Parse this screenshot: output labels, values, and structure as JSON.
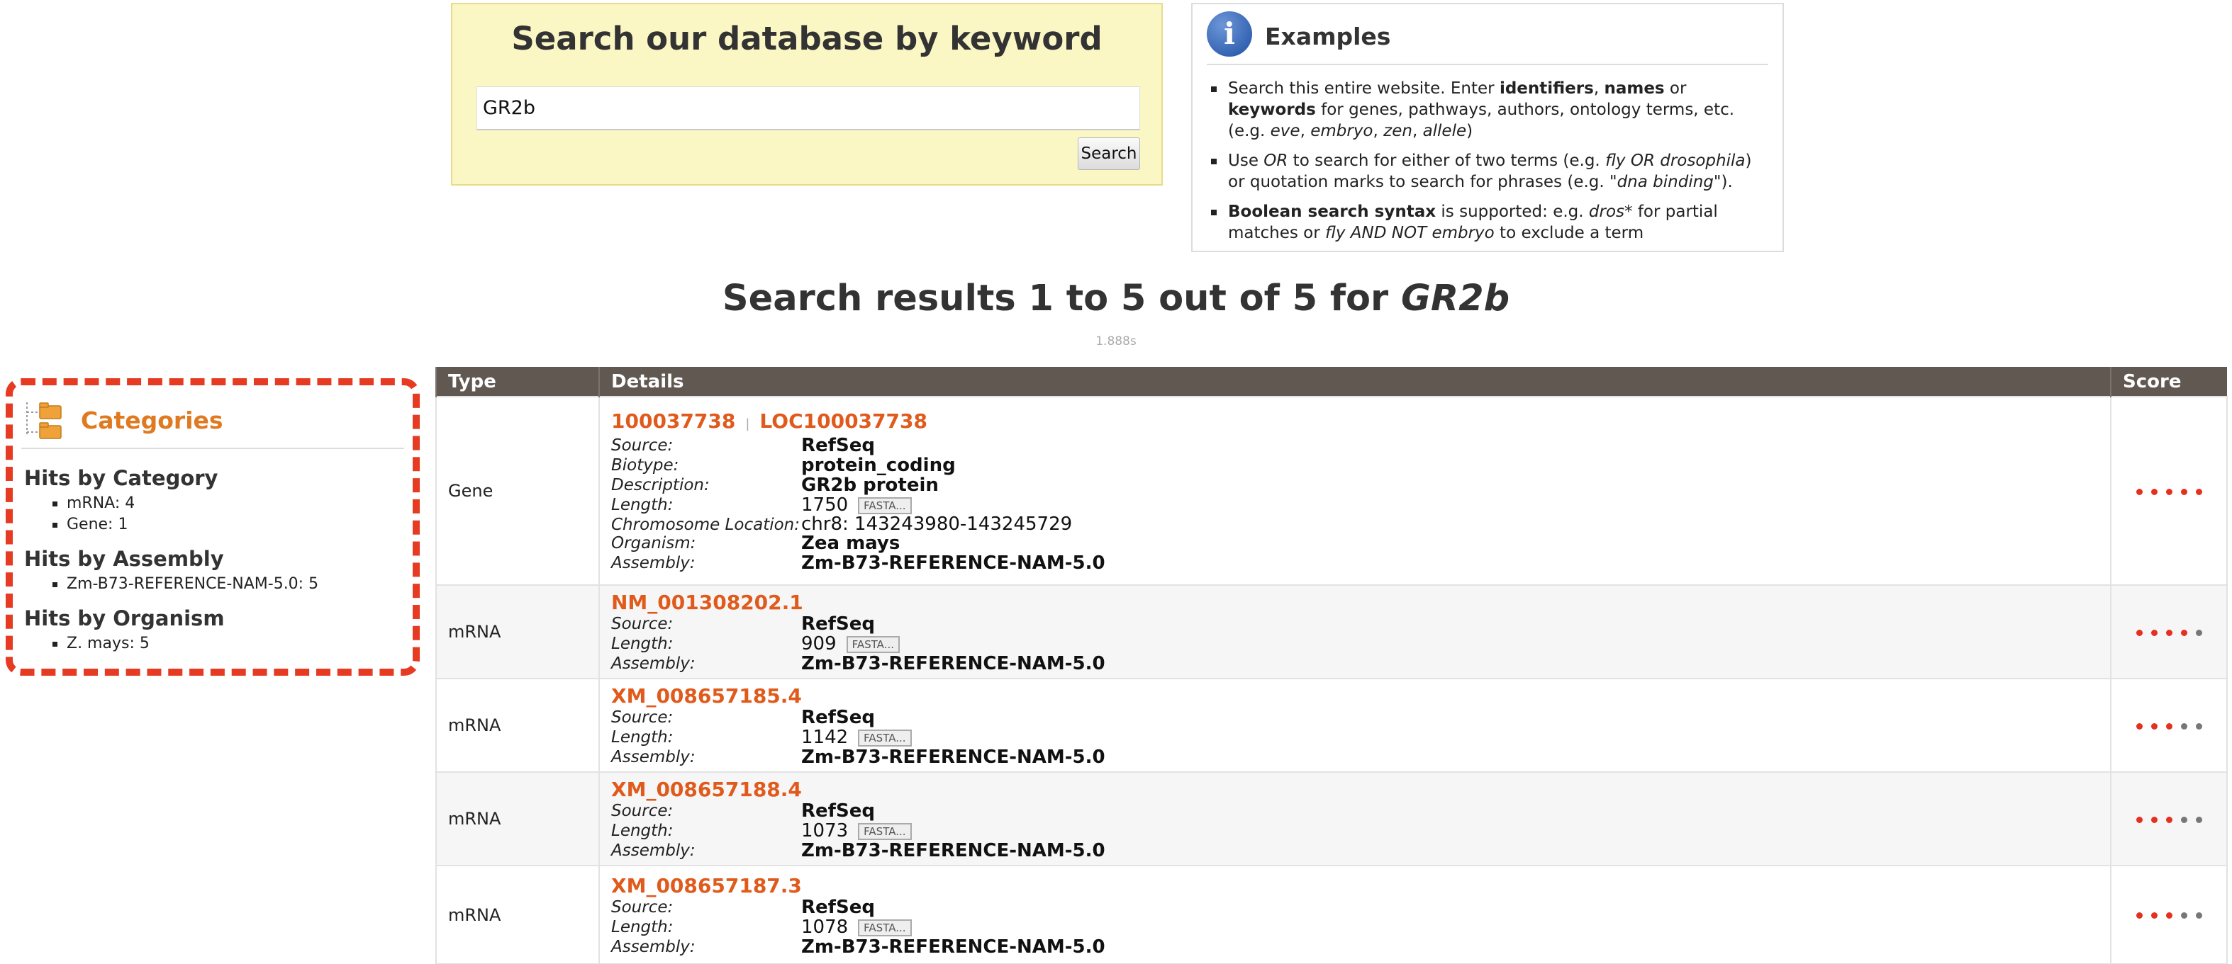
{
  "search": {
    "title": "Search our database by keyword",
    "query": "GR2b",
    "button_label": "Search"
  },
  "examples": {
    "title": "Examples",
    "items": [
      "Search this entire website. Enter identifiers, names or keywords for genes, pathways, authors, ontology terms, etc. (e.g. eve, embryo, zen, allele)",
      "Use OR to search for either of two terms (e.g. fly OR drosophila) or quotation marks to search for phrases (e.g. \"dna binding\").",
      "Boolean search syntax is supported: e.g. dros* for partial matches or fly AND NOT embryo to exclude a term"
    ]
  },
  "results": {
    "heading_prefix": "Search results 1 to 5 out of 5 for ",
    "heading_term": "GR2b",
    "timing": "1.888s"
  },
  "categories": {
    "title": "Categories",
    "groups": [
      {
        "heading": "Hits by Category",
        "items": [
          "mRNA: 4",
          "Gene: 1"
        ]
      },
      {
        "heading": "Hits by Assembly",
        "items": [
          "Zm-B73-REFERENCE-NAM-5.0: 5"
        ]
      },
      {
        "heading": "Hits by Organism",
        "items": [
          "Z. mays: 5"
        ]
      }
    ]
  },
  "table": {
    "columns": [
      "Type",
      "Details",
      "Score"
    ],
    "fasta_label": "FASTA...",
    "labels": {
      "source": "Source:",
      "biotype": "Biotype:",
      "description": "Description:",
      "length": "Length:",
      "chromosome_location": "Chromosome Location:",
      "organism": "Organism:",
      "assembly": "Assembly:"
    },
    "rows": [
      {
        "type": "Gene",
        "id": "100037738",
        "alt_id": "LOC100037738",
        "source": "RefSeq",
        "biotype": "protein_coding",
        "description": "GR2b protein",
        "length": "1750",
        "chromosome_location": "chr8: 143243980-143245729",
        "organism": "Zea mays",
        "assembly": "Zm-B73-REFERENCE-NAM-5.0",
        "score": 5
      },
      {
        "type": "mRNA",
        "id": "NM_001308202.1",
        "source": "RefSeq",
        "length": "909",
        "assembly": "Zm-B73-REFERENCE-NAM-5.0",
        "score": 4
      },
      {
        "type": "mRNA",
        "id": "XM_008657185.4",
        "source": "RefSeq",
        "length": "1142",
        "assembly": "Zm-B73-REFERENCE-NAM-5.0",
        "score": 3
      },
      {
        "type": "mRNA",
        "id": "XM_008657188.4",
        "source": "RefSeq",
        "length": "1073",
        "assembly": "Zm-B73-REFERENCE-NAM-5.0",
        "score": 3
      },
      {
        "type": "mRNA",
        "id": "XM_008657187.3",
        "source": "RefSeq",
        "length": "1078",
        "assembly": "Zm-B73-REFERENCE-NAM-5.0",
        "score": 3
      }
    ]
  }
}
